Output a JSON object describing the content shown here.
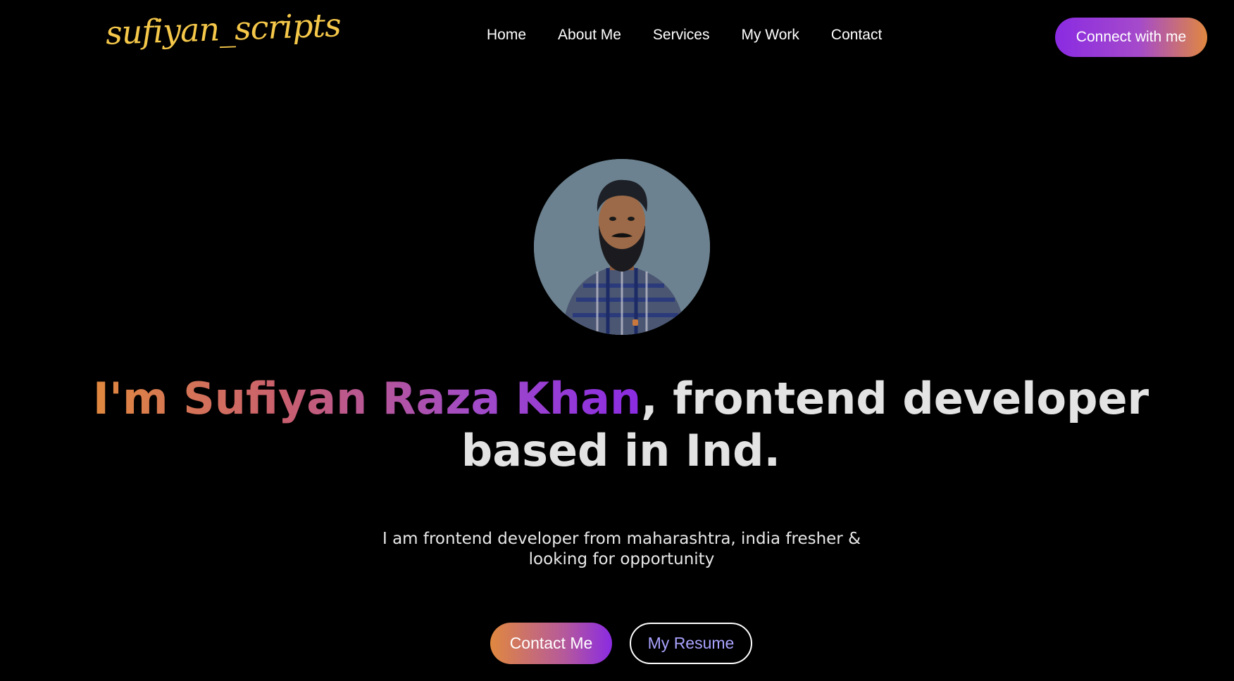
{
  "header": {
    "logo_text": "sufiyan_scripts",
    "nav": [
      {
        "label": "Home"
      },
      {
        "label": "About Me"
      },
      {
        "label": "Services"
      },
      {
        "label": "My Work"
      },
      {
        "label": "Contact"
      }
    ],
    "connect_label": "Connect with me"
  },
  "hero": {
    "headline_highlight": "I'm Sufiyan Raza Khan",
    "headline_rest": ", frontend developer based in Ind.",
    "subtext": "I am frontend developer from maharashtra, india fresher & looking for opportunity",
    "contact_label": "Contact Me",
    "resume_label": "My Resume"
  },
  "colors": {
    "background": "#000000",
    "logo": "#f5c84a",
    "gradient_start": "#e0883f",
    "gradient_end": "#8a2be2",
    "resume_text": "#a9a3ff"
  }
}
